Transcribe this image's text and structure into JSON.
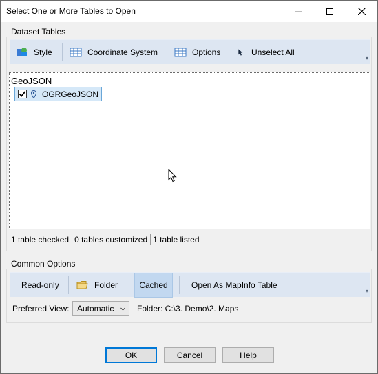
{
  "window": {
    "title": "Select One or More Tables to Open"
  },
  "dataset_tables": {
    "label": "Dataset Tables",
    "toolbar": {
      "style": "Style",
      "coordinate_system": "Coordinate System",
      "options": "Options",
      "unselect_all": "Unselect All"
    },
    "list": {
      "group": "GeoJSON",
      "items": [
        {
          "label": "OGRGeoJSON",
          "checked": true
        }
      ]
    },
    "status": {
      "checked": "1 table checked",
      "customized": "0 tables customized",
      "listed": "1 table listed"
    }
  },
  "common_options": {
    "label": "Common Options",
    "toolbar": {
      "read_only": "Read-only",
      "folder": "Folder",
      "cached": "Cached",
      "open_as_mapinfo": "Open As MapInfo Table"
    },
    "preferred_view_label": "Preferred View:",
    "preferred_view_value": "Automatic",
    "folder_path": "Folder: C:\\3. Demo\\2. Maps"
  },
  "buttons": {
    "ok": "OK",
    "cancel": "Cancel",
    "help": "Help"
  },
  "colors": {
    "toolbar_bg": "#dde6f2",
    "selected_bg": "#c2d8f0",
    "accent": "#0078d7"
  }
}
